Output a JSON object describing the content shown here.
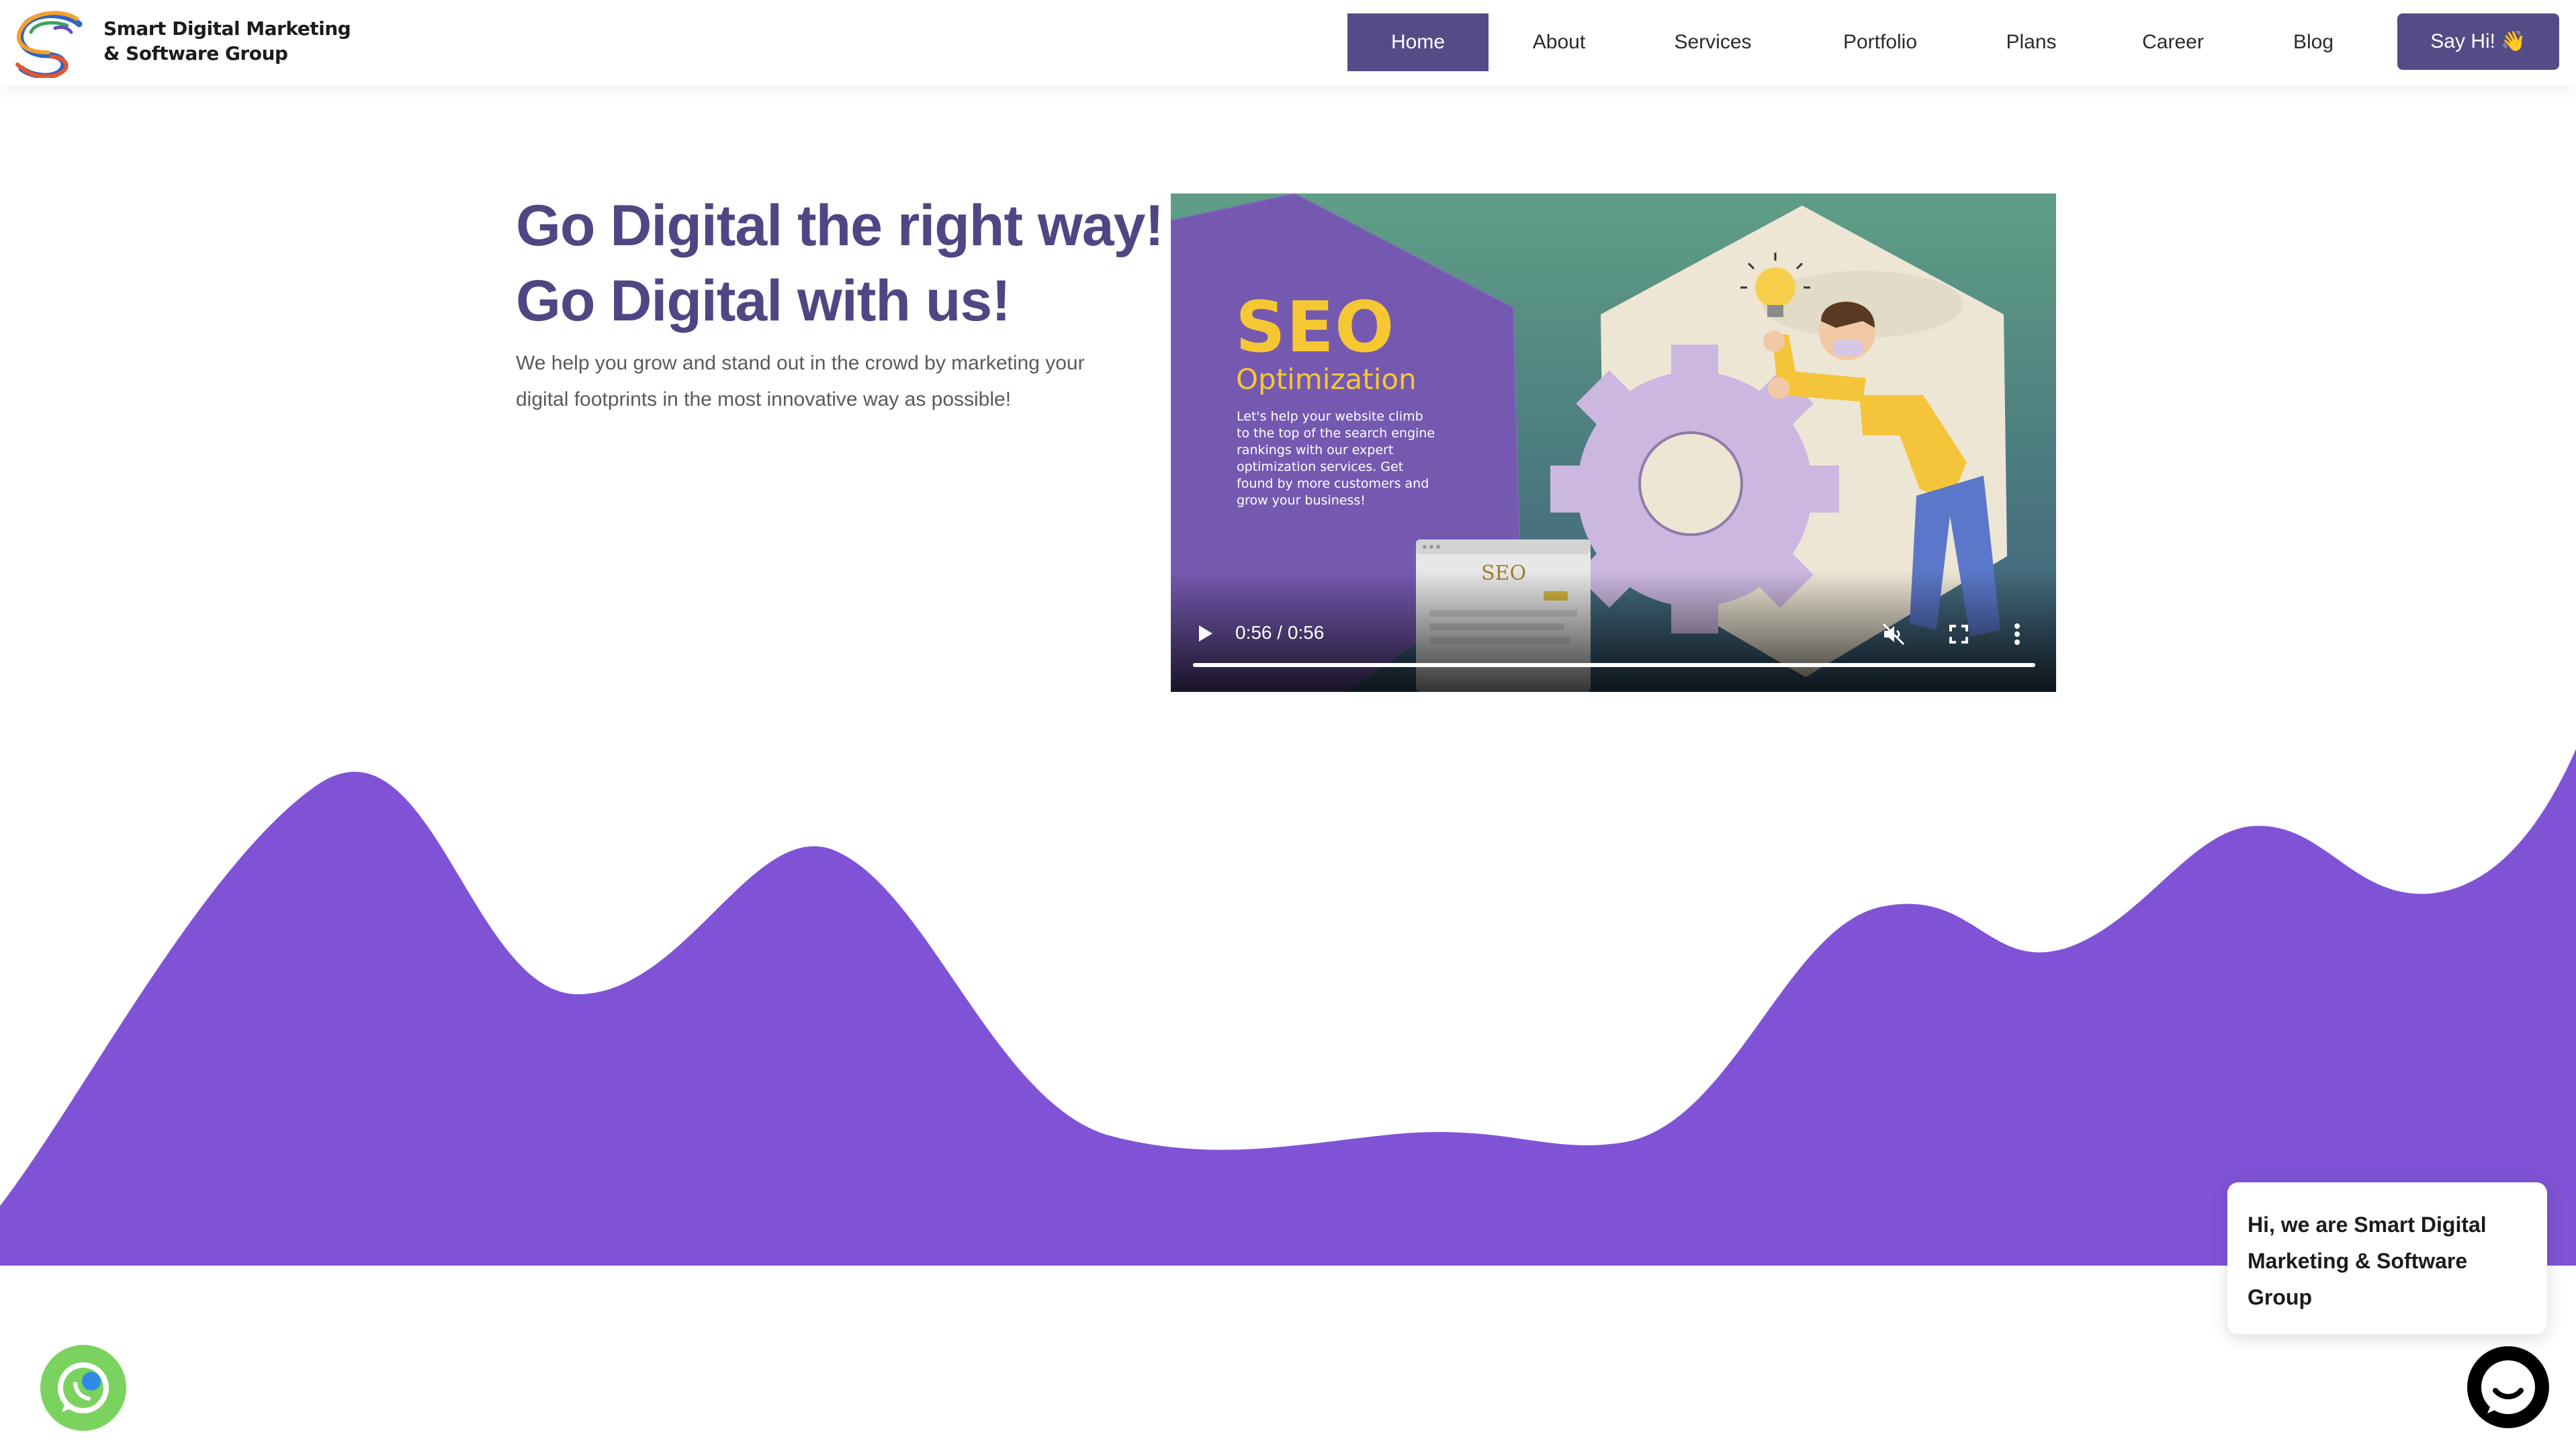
{
  "header": {
    "brand_line1": "Smart Digital Marketing",
    "brand_line2": "& Software Group",
    "nav": [
      {
        "label": "Home"
      },
      {
        "label": "About"
      },
      {
        "label": "Services"
      },
      {
        "label": "Portfolio"
      },
      {
        "label": "Plans"
      },
      {
        "label": "Career"
      },
      {
        "label": "Blog"
      }
    ],
    "active_nav": "Home",
    "cta_label": "Say Hi! 👋"
  },
  "hero": {
    "title_line1": "Go Digital the right way!",
    "title_line2": "Go Digital with us!",
    "description": "We help you grow and stand out in the crowd by marketing your digital footprints in the most innovative way as possible!"
  },
  "video": {
    "poster_title": "SEO",
    "poster_subtitle": "Optimization",
    "poster_copy": "Let's help your website climb to the top of the search engine rankings with our expert optimization services. Get found by more customers and grow your business!",
    "poster_card_label": "SEO",
    "time_display": "0:56 / 0:56",
    "progress": 1.0,
    "muted": true
  },
  "chat": {
    "greeting": "Hi, we are Smart Digital Marketing & Software Group"
  },
  "colors": {
    "primary": "#544c87",
    "heading": "#4e4783",
    "wave": "#8053d6",
    "seo_yellow": "#f5c833",
    "whatsapp": "#7bd35f"
  },
  "icons": {
    "play": "play-icon",
    "mute": "volume-muted-icon",
    "fullscreen": "fullscreen-icon",
    "more": "more-vertical-icon",
    "whatsapp": "whatsapp-icon",
    "chat": "chat-icon"
  }
}
